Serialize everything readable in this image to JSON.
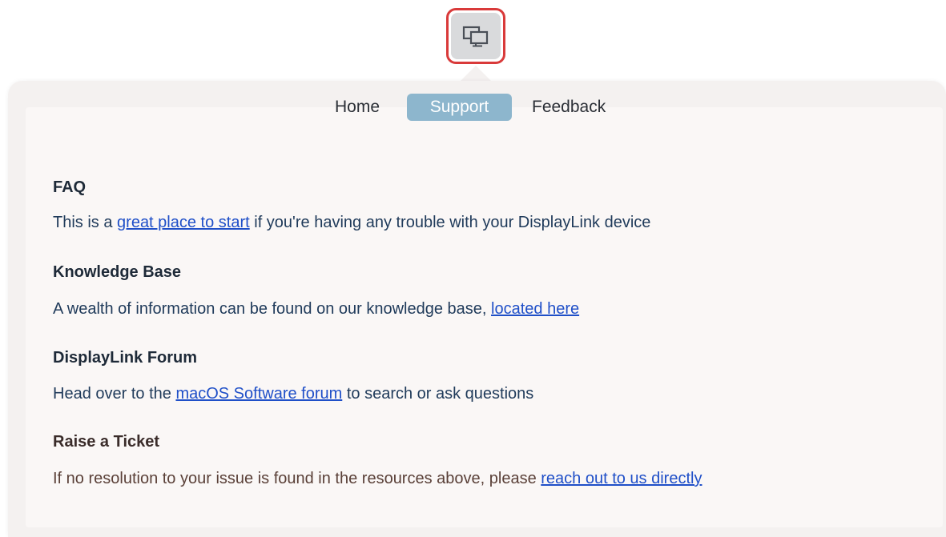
{
  "menubar": {
    "icon": "displaylink-displays-icon"
  },
  "tabs": [
    {
      "label": "Home",
      "active": false
    },
    {
      "label": "Support",
      "active": true
    },
    {
      "label": "Feedback",
      "active": false
    }
  ],
  "sections": {
    "faq": {
      "title": "FAQ",
      "text_before": "This is a ",
      "link": "great place to start",
      "text_after": " if you're having any trouble with your DisplayLink device"
    },
    "knowledge_base": {
      "title": "Knowledge Base",
      "text_before": "A wealth of information can be found on our knowledge base, ",
      "link": "located here",
      "text_after": ""
    },
    "forum": {
      "title": "DisplayLink Forum",
      "text_before": "Head over to the ",
      "link": "macOS Software forum",
      "text_after": " to search or ask questions"
    },
    "ticket": {
      "title": "Raise a Ticket",
      "text_before": "If no resolution to your issue is found in the resources above, please ",
      "link": "reach out to us directly",
      "text_after": ""
    }
  },
  "colors": {
    "highlight_border": "#d93a3a",
    "active_tab": "#8db6cd",
    "link": "#1f4fc8"
  }
}
